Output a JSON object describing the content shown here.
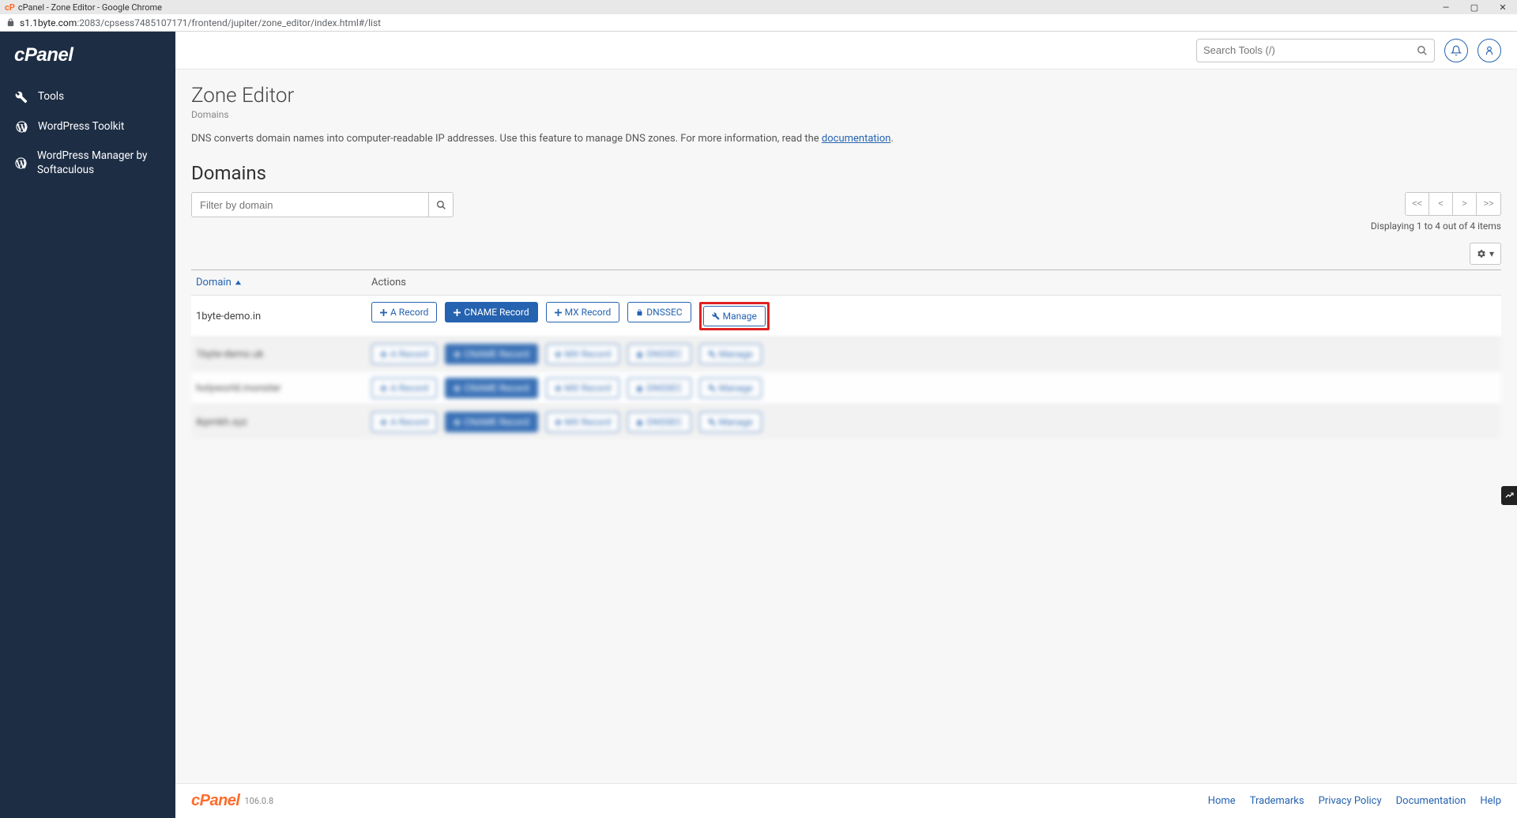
{
  "window": {
    "title": "cPanel - Zone Editor - Google Chrome"
  },
  "address": {
    "host": "s1.1byte.com",
    "path": ":2083/cpsess7485107171/frontend/jupiter/zone_editor/index.html#/list"
  },
  "sidebar": {
    "logo": "cPanel",
    "items": [
      {
        "label": "Tools",
        "icon": "tools"
      },
      {
        "label": "WordPress Toolkit",
        "icon": "wordpress"
      },
      {
        "label": "WordPress Manager by Softaculous",
        "icon": "wordpress"
      }
    ]
  },
  "topbar": {
    "search_placeholder": "Search Tools (/)"
  },
  "page": {
    "title": "Zone Editor",
    "breadcrumb": "Domains",
    "description_pre": "DNS converts domain names into computer-readable IP addresses. Use this feature to manage DNS zones. For more information, read the ",
    "description_link": "documentation",
    "description_post": "."
  },
  "domains": {
    "heading": "Domains",
    "filter_placeholder": "Filter by domain",
    "pagination": {
      "first": "<<",
      "prev": "<",
      "next": ">",
      "last": ">>",
      "text": "Displaying 1 to 4 out of 4 items"
    },
    "columns": {
      "domain": "Domain",
      "actions": "Actions"
    },
    "action_labels": {
      "a": "A Record",
      "cname": "CNAME Record",
      "mx": "MX Record",
      "dnssec": "DNSSEC",
      "manage": "Manage"
    },
    "rows": [
      {
        "domain": "1byte-demo.in",
        "blurred": false,
        "highlight_manage": true
      },
      {
        "domain": "1byte-demo.uk",
        "blurred": true,
        "highlight_manage": false
      },
      {
        "domain": "holyworld.monster",
        "blurred": true,
        "highlight_manage": false
      },
      {
        "domain": "ikpmkh.xyz",
        "blurred": true,
        "highlight_manage": false
      }
    ]
  },
  "footer": {
    "logo": "cPanel",
    "version": "106.0.8",
    "links": [
      "Home",
      "Trademarks",
      "Privacy Policy",
      "Documentation",
      "Help"
    ]
  }
}
